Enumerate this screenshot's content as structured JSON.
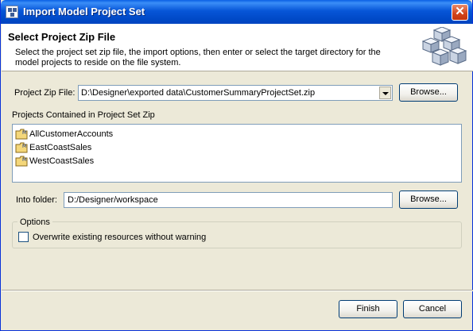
{
  "window": {
    "title": "Import Model Project Set",
    "close_glyph": "✕"
  },
  "header": {
    "title": "Select Project Zip File",
    "description": "Select the project set zip file, the import options, then enter or select the target directory for the model projects to reside on the file system.",
    "graphic": "cubes-wizard-icon"
  },
  "zip_file": {
    "label": "Project Zip File:",
    "value": "D:\\Designer\\exported data\\CustomerSummaryProjectSet.zip",
    "browse_label": "Browse..."
  },
  "projects": {
    "label": "Projects Contained in Project Set Zip",
    "item_icon": "model-project-folder-icon",
    "items": [
      {
        "label": "AllCustomerAccounts"
      },
      {
        "label": "EastCoastSales"
      },
      {
        "label": "WestCoastSales"
      }
    ]
  },
  "into_folder": {
    "label": "Into folder:",
    "value": "D:/Designer/workspace",
    "browse_label": "Browse..."
  },
  "options": {
    "label": "Options",
    "overwrite": {
      "label": "Overwrite existing resources without warning",
      "checked": false
    }
  },
  "footer": {
    "finish_label": "Finish",
    "cancel_label": "Cancel"
  }
}
